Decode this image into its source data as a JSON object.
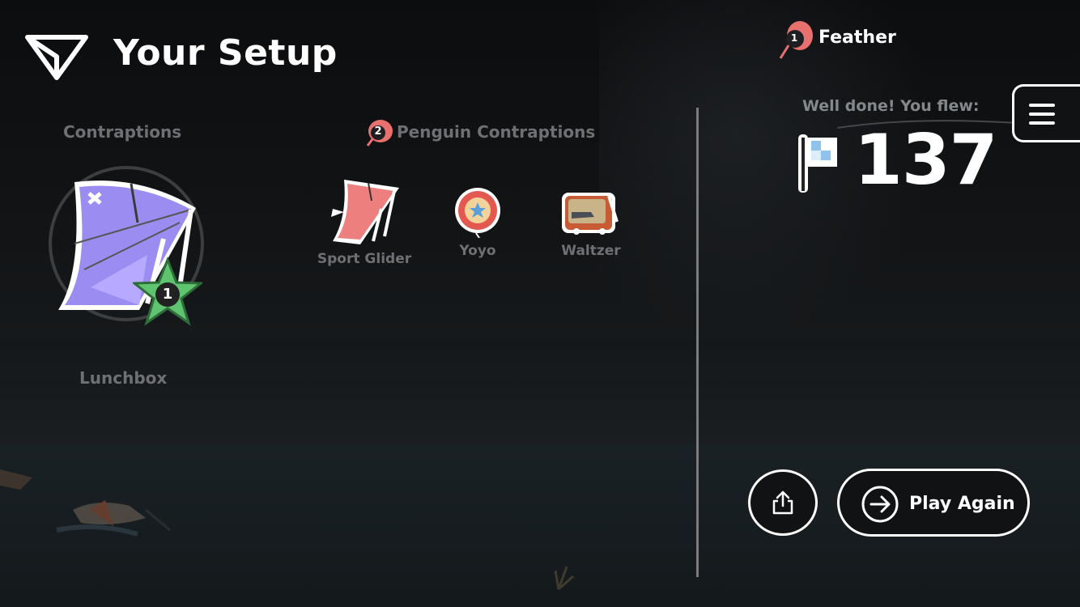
{
  "header": {
    "title": "Your Setup",
    "logo_icon": "paper-plane-logo-icon"
  },
  "setup": {
    "contraptions_label": "Contraptions",
    "main_item_rank": "1",
    "lunchbox_label": "Lunchbox",
    "penguin_badge_number": "2",
    "penguin_label": "Penguin Contraptions",
    "items": [
      {
        "label": "Sport Glider",
        "icon": "sport-glider-icon"
      },
      {
        "label": "Yoyo",
        "icon": "yoyo-icon"
      },
      {
        "label": "Waltzer",
        "icon": "waltzer-icon"
      }
    ]
  },
  "result": {
    "feather_count": "1",
    "feather_label": "Feather",
    "well_done": "Well done! You flew:",
    "distance": "137"
  },
  "actions": {
    "play_again": "Play Again"
  },
  "colors": {
    "glider_purple": "#9b8cf2",
    "glider_pink": "#ee7f7f",
    "star_green": "#5fc46f",
    "badge_red": "#e8706e"
  }
}
